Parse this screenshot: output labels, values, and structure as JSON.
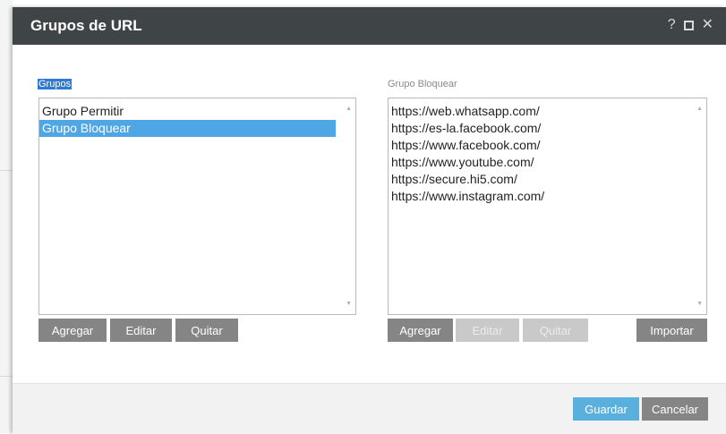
{
  "window": {
    "title": "Grupos de URL",
    "help_glyph": "?",
    "close_glyph": "✕"
  },
  "groups": {
    "label": "Grupos",
    "items": [
      {
        "label": "Grupo Permitir",
        "selected": false
      },
      {
        "label": "Grupo Bloquear",
        "selected": true
      }
    ],
    "buttons": {
      "add": "Agregar",
      "edit": "Editar",
      "remove": "Quitar"
    }
  },
  "block_group": {
    "label": "Grupo Bloquear",
    "urls": [
      "https://web.whatsapp.com/",
      "https://es-la.facebook.com/",
      "https://www.facebook.com/",
      "https://www.youtube.com/",
      "https://secure.hi5.com/",
      "https://www.instagram.com/"
    ],
    "buttons": {
      "add": "Agregar",
      "edit": "Editar",
      "remove": "Quitar",
      "import": "Importar"
    }
  },
  "footer": {
    "save": "Guardar",
    "cancel": "Cancelar"
  },
  "colors": {
    "titlebar": "#3f4447",
    "selection": "#4fa6e5",
    "button": "#858585",
    "primary_button": "#5ab0dc"
  }
}
